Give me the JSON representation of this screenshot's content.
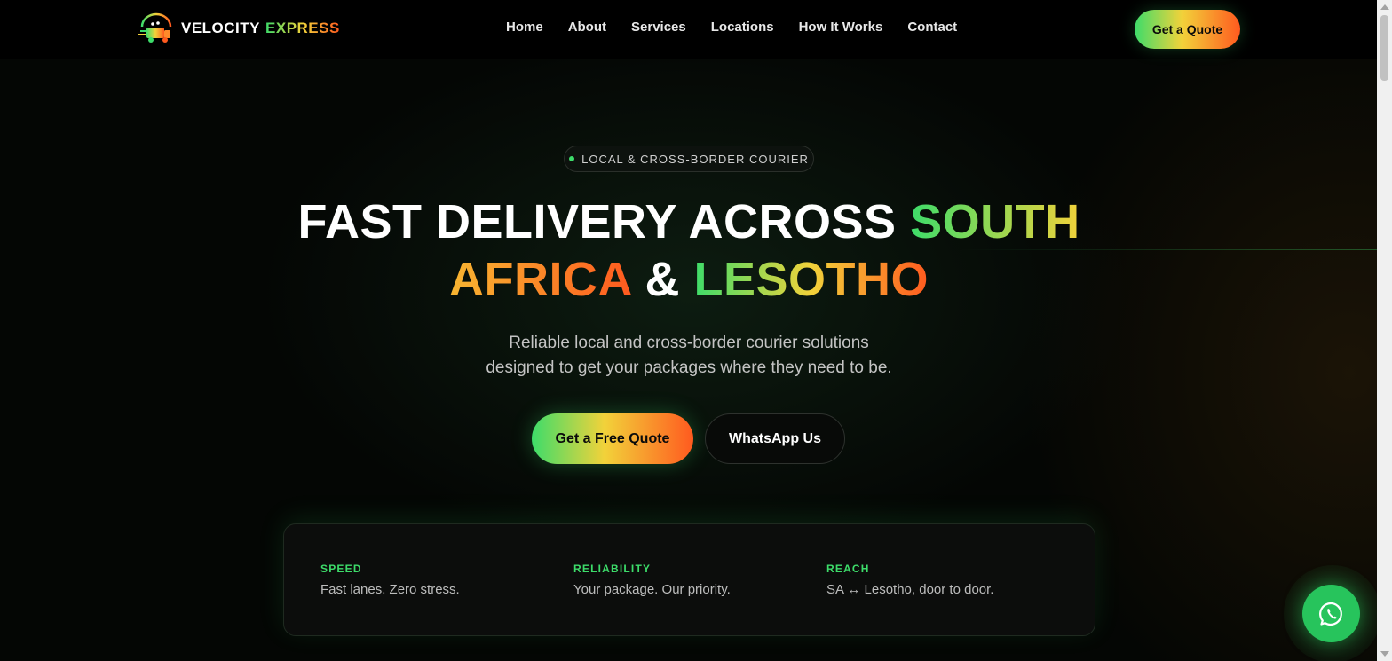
{
  "header": {
    "brand": {
      "word1": "VELOCITY",
      "word2": "EXPRESS",
      "logo_icon": "delivery-truck-logo"
    },
    "nav": [
      {
        "label": "Home"
      },
      {
        "label": "About"
      },
      {
        "label": "Services"
      },
      {
        "label": "Locations"
      },
      {
        "label": "How It Works"
      },
      {
        "label": "Contact"
      }
    ],
    "cta_label": "Get a Quote"
  },
  "hero": {
    "badge": "LOCAL & CROSS-BORDER COURIER",
    "headline": {
      "part1": "FAST DELIVERY ACROSS ",
      "part2": "SOUTH",
      "part3": "AFRICA",
      "part4": " & ",
      "part5": "LESOTHO"
    },
    "subtitle_line1": "Reliable local and cross-border courier solutions",
    "subtitle_line2": "designed to get your packages where they need to be.",
    "primary_button": "Get a Free Quote",
    "secondary_button": "WhatsApp Us"
  },
  "features": [
    {
      "title": "SPEED",
      "desc": "Fast lanes. Zero stress."
    },
    {
      "title": "RELIABILITY",
      "desc": "Your package. Our priority."
    },
    {
      "title": "REACH",
      "desc": "SA ↔ Lesotho, door to door."
    }
  ],
  "floating_button": {
    "icon": "whatsapp-icon"
  },
  "colors": {
    "accent_green": "#3ddc6a",
    "accent_yellow": "#f2d23a",
    "accent_orange": "#ff5a1f",
    "whatsapp_green": "#27c45c",
    "background": "#040604"
  }
}
